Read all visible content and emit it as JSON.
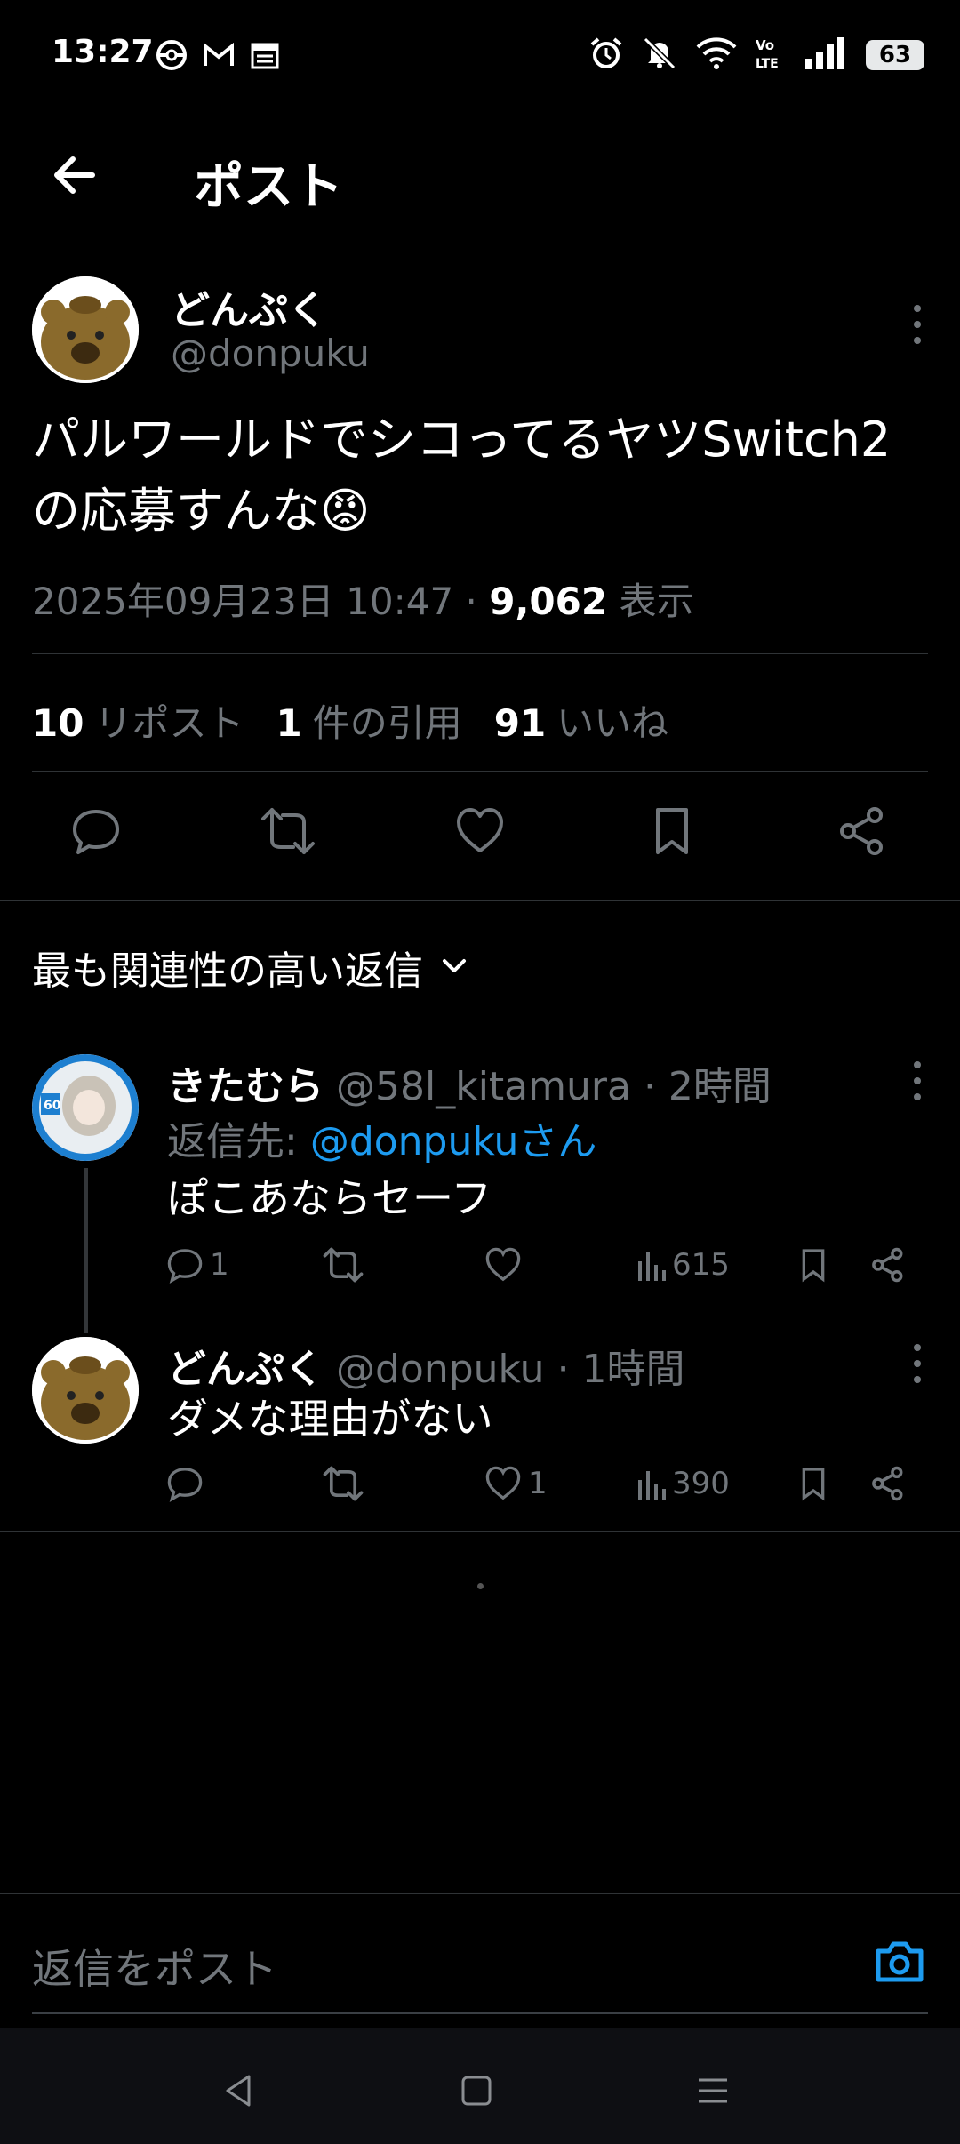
{
  "status_bar": {
    "time": "13:27",
    "battery": "63",
    "icons_left": [
      "pokeball-icon",
      "gmail-icon",
      "calendar-icon"
    ],
    "icons_right": [
      "alarm-icon",
      "mute-icon",
      "wifi-icon",
      "volte-icon",
      "signal-icon",
      "battery-icon"
    ]
  },
  "header": {
    "title": "ポスト"
  },
  "post": {
    "name": "どんぷく",
    "handle": "@donpuku",
    "text": "パルワールドでシコってるヤツSwitch2の応募すんな😡",
    "timestamp": "2025年09月23日 10:47",
    "separator": " · ",
    "views": "9,062",
    "views_label": "表示",
    "stats": [
      {
        "num": "10",
        "label": "リポスト"
      },
      {
        "num": "1",
        "label": "件の引用"
      },
      {
        "num": "91",
        "label": "いいね"
      }
    ]
  },
  "replies_sort": {
    "label": "最も関連性の高い返信"
  },
  "replies": [
    {
      "name": "きたむら",
      "handle": "@58l_kitamura",
      "time": "· 2時間",
      "reply_to_prefix": "返信先: ",
      "reply_to_link": "@donpukuさん",
      "text": "ぽこあならセーフ",
      "comments": "1",
      "retweets": "",
      "likes": "",
      "views": "615"
    },
    {
      "name": "どんぷく",
      "handle": "@donpuku",
      "time": "· 1時間",
      "text": "ダメな理由がない",
      "comments": "",
      "retweets": "",
      "likes": "1",
      "views": "390"
    }
  ],
  "composer": {
    "placeholder": "返信をポスト"
  },
  "colors": {
    "accent": "#1d9bf0",
    "muted": "#71767b",
    "background": "#000000",
    "divider": "#2f3336"
  }
}
